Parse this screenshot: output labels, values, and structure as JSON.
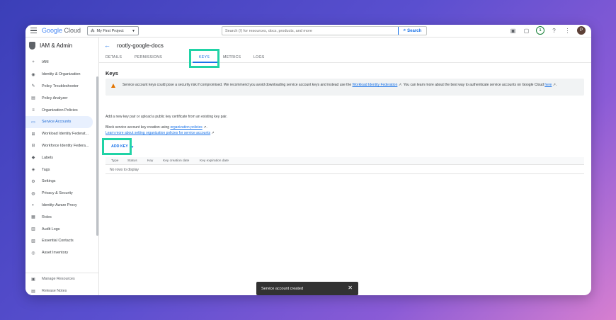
{
  "topbar": {
    "logo_google": "Google",
    "logo_cloud": " Cloud",
    "project": "My First Project",
    "search_placeholder": "Search (/) for resources, docs, products, and more",
    "search_button": "Search",
    "notification_count": "1",
    "avatar_letter": "P"
  },
  "sidebar": {
    "title": "IAM & Admin",
    "items": [
      {
        "label": "IAM",
        "icon": "person-add-icon"
      },
      {
        "label": "Identity & Organization",
        "icon": "account-circle-icon"
      },
      {
        "label": "Policy Troubleshooter",
        "icon": "wrench-icon"
      },
      {
        "label": "Policy Analyzer",
        "icon": "document-search-icon"
      },
      {
        "label": "Organization Policies",
        "icon": "list-icon"
      },
      {
        "label": "Service Accounts",
        "icon": "service-account-icon"
      },
      {
        "label": "Workload Identity Federat...",
        "icon": "workload-icon"
      },
      {
        "label": "Workforce Identity Federa...",
        "icon": "workforce-icon"
      },
      {
        "label": "Labels",
        "icon": "label-icon"
      },
      {
        "label": "Tags",
        "icon": "tag-icon"
      },
      {
        "label": "Settings",
        "icon": "gear-icon"
      },
      {
        "label": "Privacy & Security",
        "icon": "shield-icon"
      },
      {
        "label": "Identity-Aware Proxy",
        "icon": "proxy-icon"
      },
      {
        "label": "Roles",
        "icon": "roles-icon"
      },
      {
        "label": "Audit Logs",
        "icon": "audit-icon"
      },
      {
        "label": "Essential Contacts",
        "icon": "contacts-icon"
      },
      {
        "label": "Asset Inventory",
        "icon": "inventory-icon"
      }
    ],
    "active_index": 5,
    "footer": [
      {
        "label": "Manage Resources",
        "icon": "folder-icon"
      },
      {
        "label": "Release Notes",
        "icon": "notes-icon"
      }
    ]
  },
  "main": {
    "title": "rootly-google-docs",
    "tabs": [
      "DETAILS",
      "PERMISSIONS",
      "KEYS",
      "METRICS",
      "LOGS"
    ],
    "active_tab": "KEYS",
    "section_title": "Keys",
    "warning": {
      "text_before": "Service account keys could pose a security risk if compromised. We recommend you avoid downloading service account keys and instead use the ",
      "link1": "Workload Identity Federation",
      "text_mid": ". You can learn more about the best way to authenticate service accounts on Google Cloud ",
      "link2": "here",
      "text_after": "."
    },
    "add_key_desc": "Add a new key pair or upload a public key certificate from an existing key pair.",
    "block_text": "Block service account key creation using ",
    "block_link": "organization policies",
    "block_after": ".",
    "learn_link": "Learn more about setting organization policies for service accounts",
    "add_key_label": "ADD KEY",
    "table_headers": [
      "Type",
      "Status",
      "Key",
      "Key creation date",
      "Key expiration date"
    ],
    "no_rows": "No rows to display"
  },
  "snackbar": {
    "text": "Service account created"
  },
  "colors": {
    "accent": "#1a73e8",
    "highlight": "#20d3a6",
    "warning": "#e37400"
  }
}
